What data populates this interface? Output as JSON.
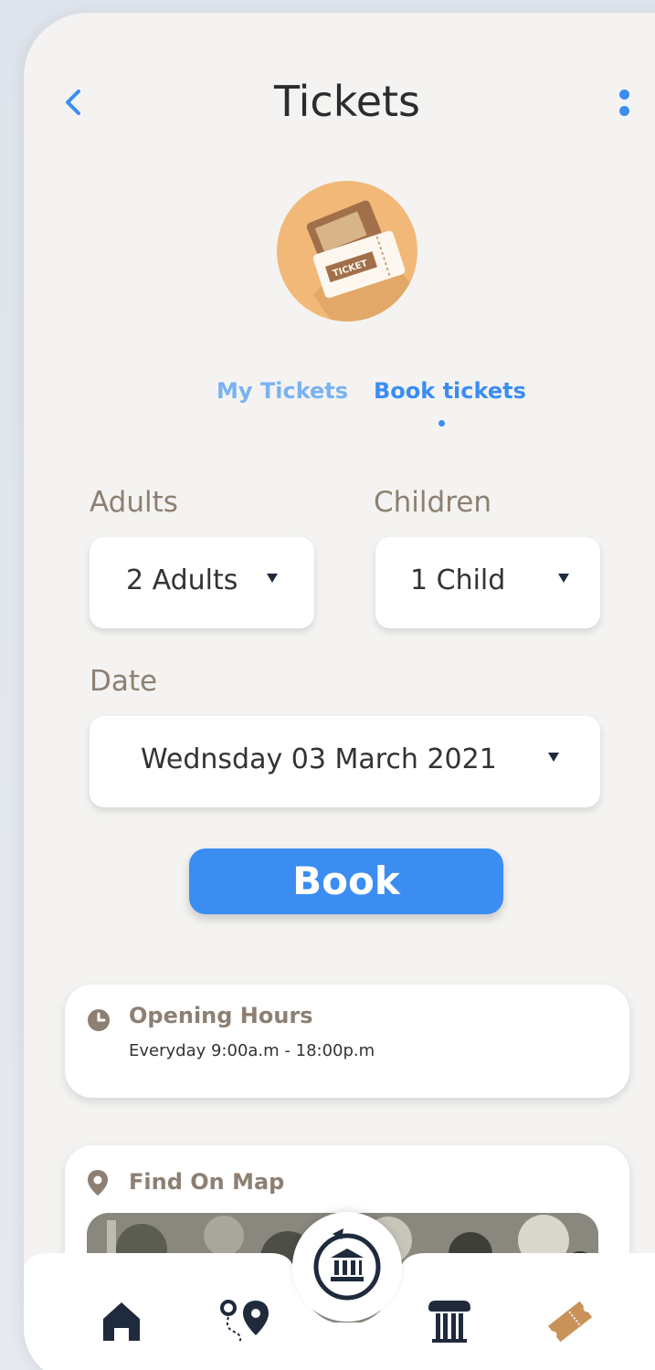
{
  "header": {
    "title": "Tickets",
    "back_icon": "chevron-left-icon",
    "more_icon": "more-vertical-icon"
  },
  "logo": {
    "icon": "ticket-icon",
    "label": "TICKET",
    "color": "#f2b878"
  },
  "tabs": [
    {
      "label": "My Tickets",
      "active": false
    },
    {
      "label": "Book tickets",
      "active": true
    }
  ],
  "form": {
    "adults_label": "Adults",
    "adults_value": "2 Adults",
    "children_label": "Children",
    "children_value": "1 Child",
    "date_label": "Date",
    "date_value": "Wednsday 03 March 2021"
  },
  "book_button": "Book",
  "opening_hours": {
    "title": "Opening Hours",
    "value": "Everyday  9:00a.m - 18:00p.m",
    "icon": "clock-icon"
  },
  "map_card": {
    "title": "Find On Map",
    "icon": "map-pin-icon"
  },
  "bottom_nav": {
    "items": [
      "home-icon",
      "route-icon",
      "museum-rotate-icon",
      "column-icon",
      "ticket-icon"
    ],
    "active": "ticket-icon"
  },
  "colors": {
    "accent": "#3b8df2",
    "label": "#8d7f72",
    "background": "#f4f3f1",
    "nav_dark": "#1f2a3c",
    "active_nav": "#c99259"
  }
}
